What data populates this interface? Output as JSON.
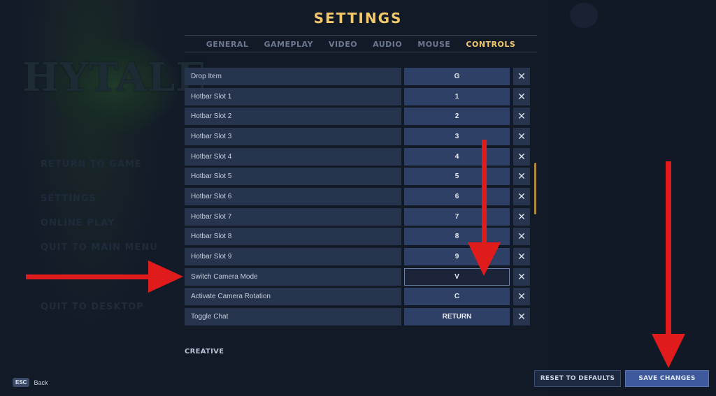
{
  "background": {
    "logo_text": "HYTALE",
    "menu": [
      "RETURN TO GAME",
      "SETTINGS",
      "ONLINE PLAY",
      "QUIT TO MAIN MENU",
      "QUIT TO DESKTOP"
    ]
  },
  "header": {
    "title": "SETTINGS"
  },
  "tabs": [
    {
      "label": "GENERAL",
      "active": false
    },
    {
      "label": "GAMEPLAY",
      "active": false
    },
    {
      "label": "VIDEO",
      "active": false
    },
    {
      "label": "AUDIO",
      "active": false
    },
    {
      "label": "MOUSE",
      "active": false
    },
    {
      "label": "CONTROLS",
      "active": true
    }
  ],
  "bindings": [
    {
      "action": "Drop Item",
      "key": "G"
    },
    {
      "action": "Hotbar Slot 1",
      "key": "1"
    },
    {
      "action": "Hotbar Slot 2",
      "key": "2"
    },
    {
      "action": "Hotbar Slot 3",
      "key": "3"
    },
    {
      "action": "Hotbar Slot 4",
      "key": "4"
    },
    {
      "action": "Hotbar Slot 5",
      "key": "5"
    },
    {
      "action": "Hotbar Slot 6",
      "key": "6"
    },
    {
      "action": "Hotbar Slot 7",
      "key": "7"
    },
    {
      "action": "Hotbar Slot 8",
      "key": "8"
    },
    {
      "action": "Hotbar Slot 9",
      "key": "9"
    },
    {
      "action": "Switch Camera Mode",
      "key": "V",
      "selected": true
    },
    {
      "action": "Activate Camera Rotation",
      "key": "C"
    },
    {
      "action": "Toggle Chat",
      "key": "RETURN"
    }
  ],
  "clear_glyph": "✕",
  "section_next": "CREATIVE",
  "footer": {
    "esc_key": "ESC",
    "esc_label": "Back",
    "reset_label": "RESET TO DEFAULTS",
    "save_label": "SAVE CHANGES"
  },
  "colors": {
    "accent": "#f2c96a",
    "annotation_arrow": "#e01b1b"
  }
}
